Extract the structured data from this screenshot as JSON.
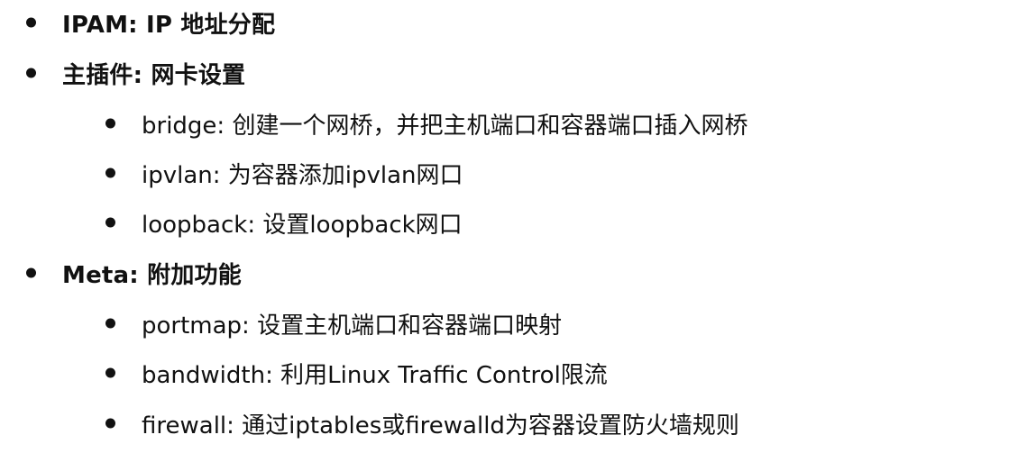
{
  "items": [
    {
      "text": "IPAM: IP 地址分配"
    },
    {
      "text": "主插件: 网卡设置",
      "children": [
        {
          "text": "bridge: 创建一个网桥，并把主机端口和容器端口插入网桥"
        },
        {
          "text": "ipvlan: 为容器添加ipvlan网口"
        },
        {
          "text": "loopback: 设置loopback网口"
        }
      ]
    },
    {
      "text": "Meta: 附加功能",
      "children": [
        {
          "text": "portmap: 设置主机端口和容器端口映射"
        },
        {
          "text": "bandwidth: 利用Linux Traffic Control限流"
        },
        {
          "text": "firewall: 通过iptables或firewalld为容器设置防火墙规则"
        }
      ]
    }
  ]
}
